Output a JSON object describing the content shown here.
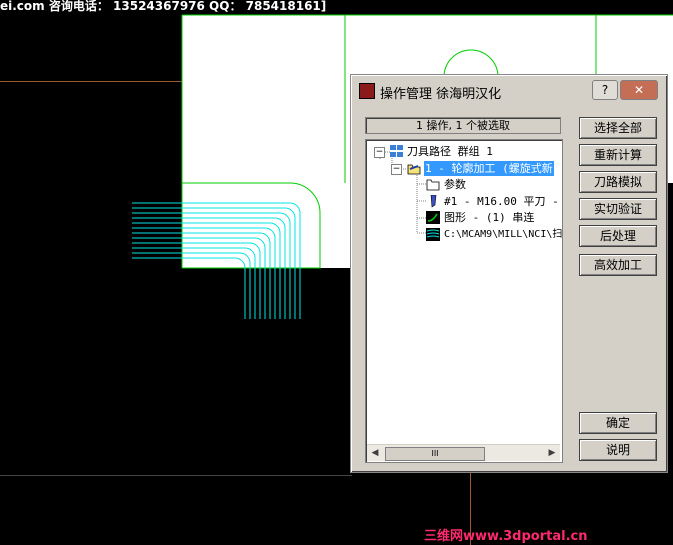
{
  "header_banner": "ei.com  咨询电话：  13524367976  QQ： 785418161]",
  "dialog": {
    "title": "操作管理 徐海明汉化",
    "help_label": "?",
    "close_label": "✕",
    "status": "1 操作, 1 个被选取",
    "tree": {
      "root": "刀具路径 群组 1",
      "operation": "1 - 轮廓加工 (螺旋式新",
      "params": "参数",
      "tool": "#1 - M16.00 平刀 -",
      "geometry": "图形 - (1) 串连",
      "nci": "C:\\MCAM9\\MILL\\NCI\\扫"
    },
    "scroll_thumb": "III",
    "buttons": {
      "select_all": "选择全部",
      "regenerate": "重新计算",
      "backplot": "刀路模拟",
      "verify": "实切验证",
      "post": "后处理",
      "high_speed": "高效加工",
      "ok": "确定",
      "help": "说明"
    }
  },
  "watermark": "三维网www.3dportal.cn",
  "colors": {
    "background": "#000000",
    "toolpath": "#00e5e5",
    "geometry": "#00cc00",
    "selection": "#3399ff",
    "axis": "#9a5a2a"
  }
}
